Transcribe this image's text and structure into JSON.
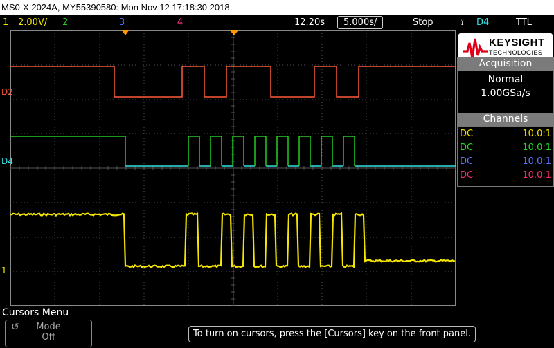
{
  "title": "MS0-X 2024A, MY55390580: Mon Nov 12 17:18:30 2018",
  "status": {
    "ch1_num": "1",
    "ch1_scale": "2.00V/",
    "ch2_num": "2",
    "ch3_num": "3",
    "ch4_num": "4",
    "time_delay": "12.20s",
    "time_scale": "5.000s/",
    "run_state": "Stop",
    "trigger_source": "D4",
    "trigger_level": "TTL"
  },
  "traces": {
    "d2_label": "D2",
    "d4_label": "D4",
    "ch1_label": "1"
  },
  "brand": {
    "name": "KEYSIGHT",
    "sub": "TECHNOLOGIES"
  },
  "acquisition": {
    "header": "Acquisition",
    "mode": "Normal",
    "rate": "1.00GSa/s"
  },
  "channels": {
    "header": "Channels",
    "rows": [
      {
        "coupling": "DC",
        "ratio": "10.0:1",
        "color": "#f0e000"
      },
      {
        "coupling": "DC",
        "ratio": "10.0:1",
        "color": "#22dd22"
      },
      {
        "coupling": "DC",
        "ratio": "10.0:1",
        "color": "#5a78ff"
      },
      {
        "coupling": "DC",
        "ratio": "10.0:1",
        "color": "#ff2a7a"
      }
    ]
  },
  "menu": {
    "title": "Cursors Menu",
    "mode_label": "Mode",
    "mode_value": "Off"
  },
  "hint": "To turn on cursors, press the [Cursors] key on the front panel.",
  "colors": {
    "ch1": "#f4e600",
    "ch2": "#22cc22",
    "ch3": "#4f6bff",
    "ch4": "#ff3a8a",
    "d2": "#ff5a3a",
    "d4": "#30e0e0",
    "trigger_marker": "#ff9a00"
  }
}
